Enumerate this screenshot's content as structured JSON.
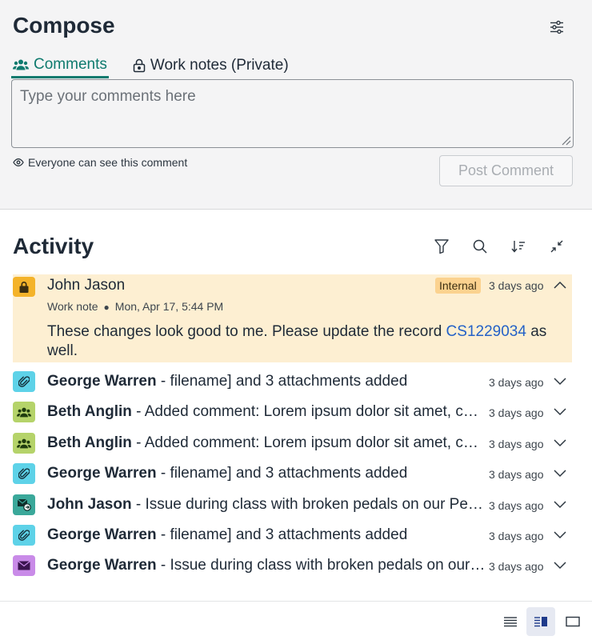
{
  "compose": {
    "title": "Compose",
    "tabs": [
      {
        "label": "Comments",
        "icon": "people-icon",
        "active": true
      },
      {
        "label": "Work notes (Private)",
        "icon": "lock-icon",
        "active": false
      }
    ],
    "input": {
      "placeholder": "Type your comments here",
      "value": ""
    },
    "visibility_text": "Everyone can see this comment",
    "post_label": "Post Comment"
  },
  "activity": {
    "title": "Activity",
    "toolbar": [
      "filter-icon",
      "search-icon",
      "sort-icon",
      "collapse-icon"
    ],
    "expanded": {
      "author": "John Jason",
      "badge": "Internal",
      "time": "3 days ago",
      "type": "Work note",
      "date": "Mon, Apr 17, 5:44 PM",
      "body_pre": "These changes look good to me. Please update the record ",
      "link": "CS1229034",
      "body_post": " as well."
    },
    "items": [
      {
        "author": "George Warren",
        "text": " - filename] and 3 attachments added",
        "time": "3 days ago",
        "icon": "paperclip-icon",
        "color": "#5ed2e8"
      },
      {
        "author": "Beth Anglin",
        "text": " - Added comment: Lorem ipsum dolor sit amet, consectetur adipiscing elit",
        "time": "3 days ago",
        "icon": "people-icon",
        "color": "#b5d36a"
      },
      {
        "author": "Beth Anglin",
        "text": " - Added comment: Lorem ipsum dolor sit amet, consectetur adipiscing elit",
        "time": "3 days ago",
        "icon": "people-icon",
        "color": "#b5d36a"
      },
      {
        "author": "George Warren",
        "text": " - filename] and 3 attachments added",
        "time": "3 days ago",
        "icon": "paperclip-icon",
        "color": "#5ed2e8"
      },
      {
        "author": "John Jason",
        "text": " - Issue during class with broken pedals on our Peloton bike",
        "time": "3 days ago",
        "icon": "email-forward-icon",
        "color": "#3aa89a"
      },
      {
        "author": "George Warren",
        "text": " - filename] and 3 attachments added",
        "time": "3 days ago",
        "icon": "paperclip-icon",
        "color": "#5ed2e8"
      },
      {
        "author": "George Warren",
        "text": " - Issue during class with broken pedals on our bike",
        "time": "3 days ago",
        "icon": "envelope-icon",
        "color": "#c98be8"
      }
    ]
  },
  "view_modes": [
    "list-view-icon",
    "split-view-icon",
    "single-view-icon"
  ],
  "colors": {
    "accent": "#0e7a6e",
    "link": "#2461c7",
    "highlight": "#fdefd2",
    "badge": "#fbd28f",
    "lock": "#f4b32a"
  }
}
